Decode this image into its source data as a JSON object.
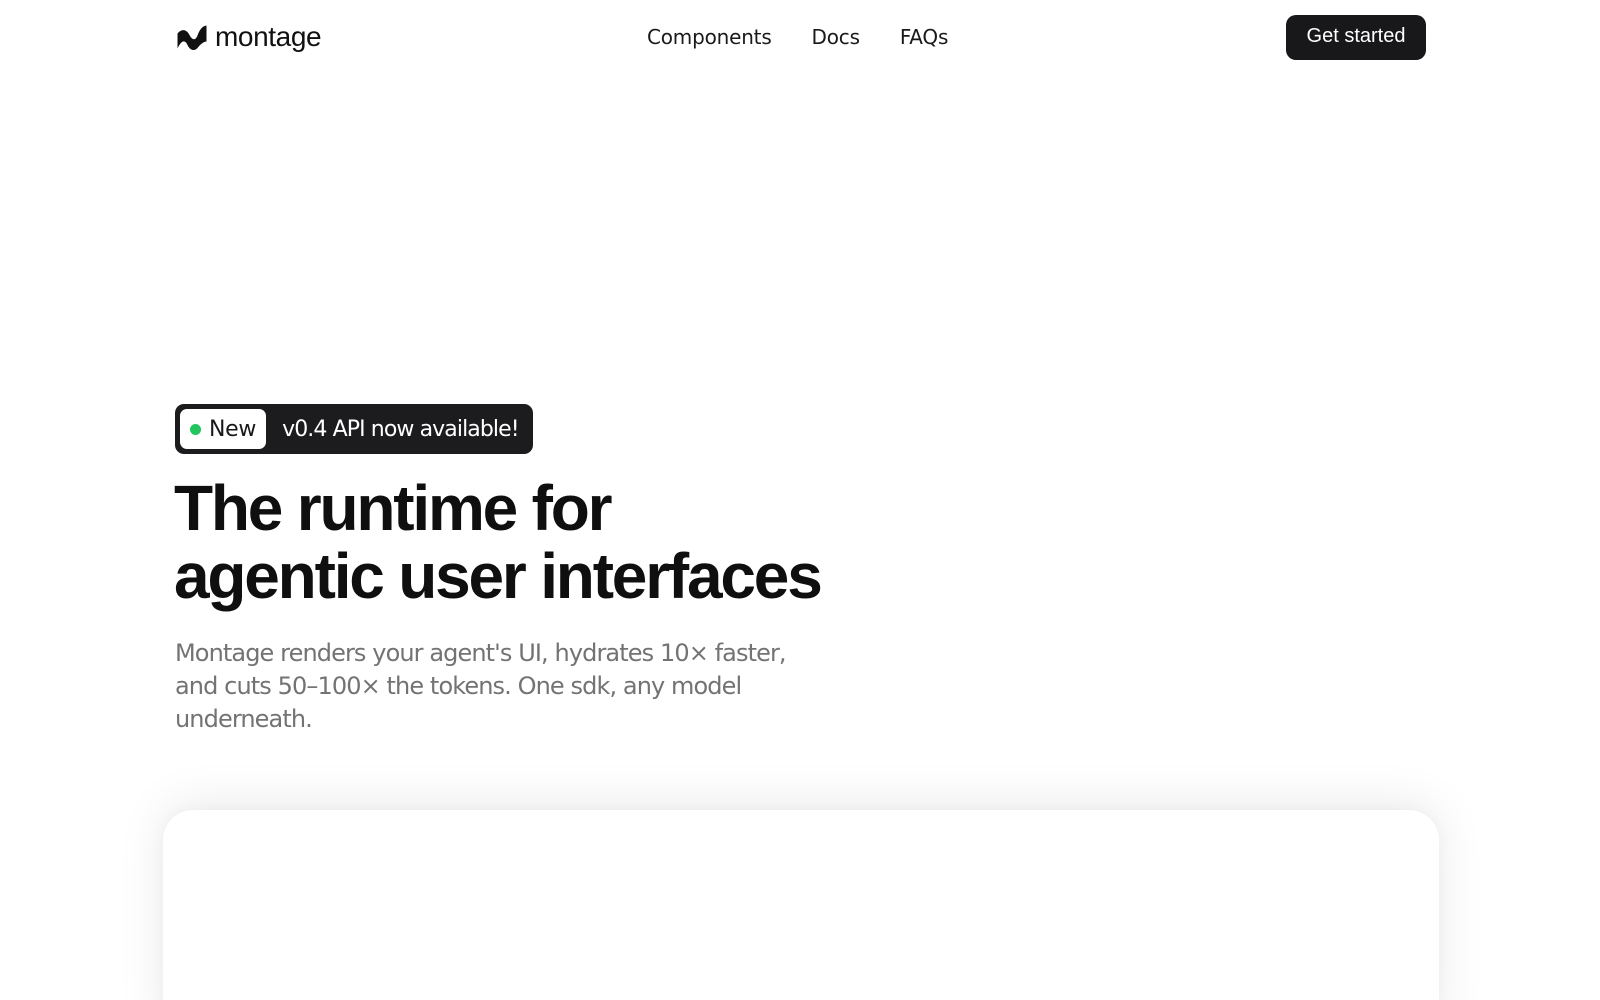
{
  "brand": {
    "name": "montage",
    "logo_icon": "montage-wave-logo-icon"
  },
  "nav": {
    "items": [
      {
        "label": "Components"
      },
      {
        "label": "Docs"
      },
      {
        "label": "FAQs"
      }
    ]
  },
  "header": {
    "cta_label": "Get started"
  },
  "hero": {
    "announcement": {
      "badge_label": "New",
      "text": "v0.4 API now available!"
    },
    "headline": {
      "line1": "The runtime for",
      "line2": "agentic user interfaces"
    },
    "subtext": "Montage renders your agent's UI, hydrates 10× faster, and cuts 50–100× the tokens. One sdk, any model underneath."
  },
  "colors": {
    "accent_dark": "#18181b",
    "status_green": "#22c55e",
    "muted_text": "#737373",
    "background": "#ffffff"
  }
}
